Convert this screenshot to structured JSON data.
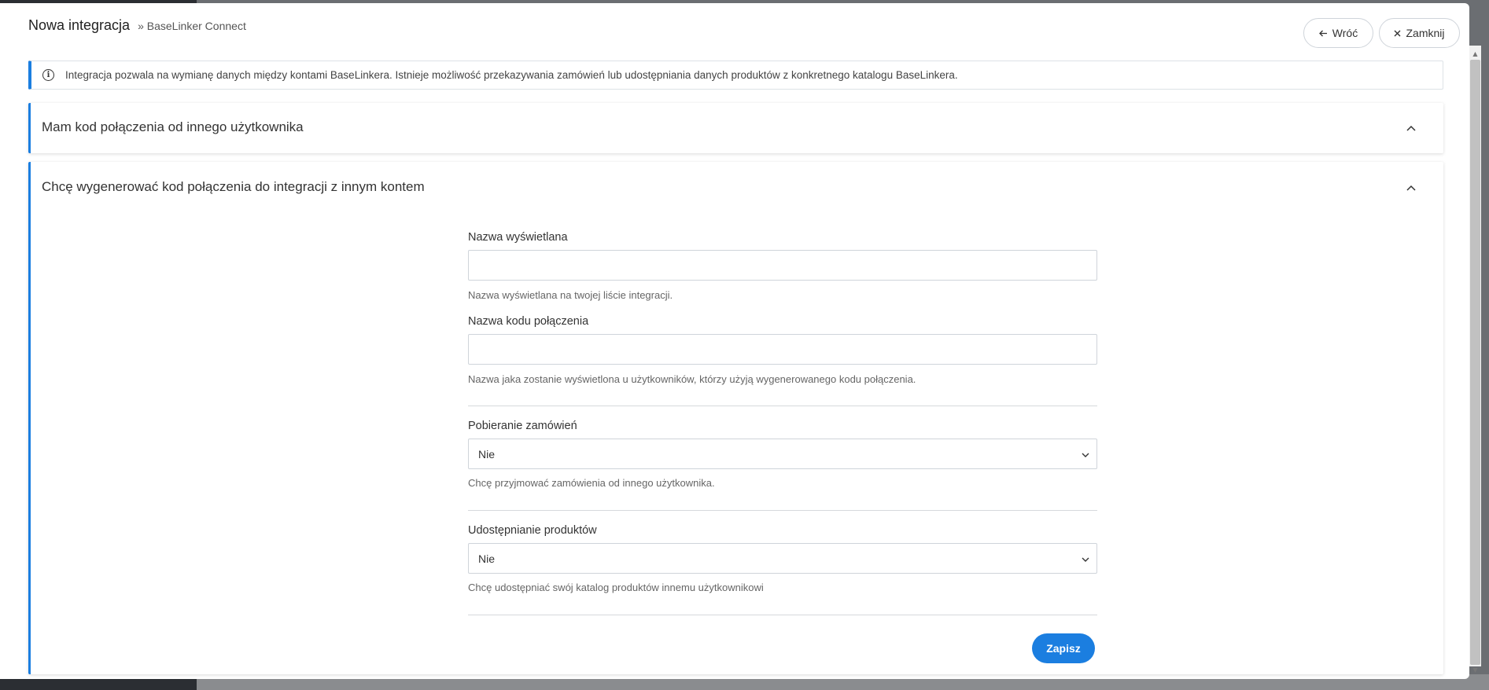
{
  "modal": {
    "title": "Nowa integracja",
    "subtitle": "» BaseLinker Connect",
    "back_label": "Wróć",
    "close_label": "Zamknij"
  },
  "info": {
    "text": "Integracja pozwala na wymianę danych między kontami BaseLinkera. Istnieje możliwość przekazywania zamówień lub udostępniania danych produktów z konkretnego katalogu BaseLinkera."
  },
  "panels": [
    {
      "title": "Mam kod połączenia od innego użytkownika",
      "state": "collapsed"
    },
    {
      "title": "Chcę wygenerować kod połączenia do integracji z innym kontem",
      "state": "expanded"
    }
  ],
  "form": {
    "display_name": {
      "label": "Nazwa wyświetlana",
      "value": "",
      "help": "Nazwa wyświetlana na twojej liście integracji."
    },
    "connection_code_name": {
      "label": "Nazwa kodu połączenia",
      "value": "",
      "help": "Nazwa jaka zostanie wyświetlona u użytkowników, którzy użyją wygenerowanego kodu połączenia."
    },
    "order_fetching": {
      "label": "Pobieranie zamówień",
      "selected": "Nie",
      "help": "Chcę przyjmować zamówienia od innego użytkownika."
    },
    "product_sharing": {
      "label": "Udostępnianie produktów",
      "selected": "Nie",
      "help": "Chcę udostępniać swój katalog produktów innemu użytkownikowi"
    },
    "save_label": "Zapisz"
  },
  "colors": {
    "accent": "#1b7ee0",
    "border": "#cfd4da",
    "text": "#333333"
  }
}
